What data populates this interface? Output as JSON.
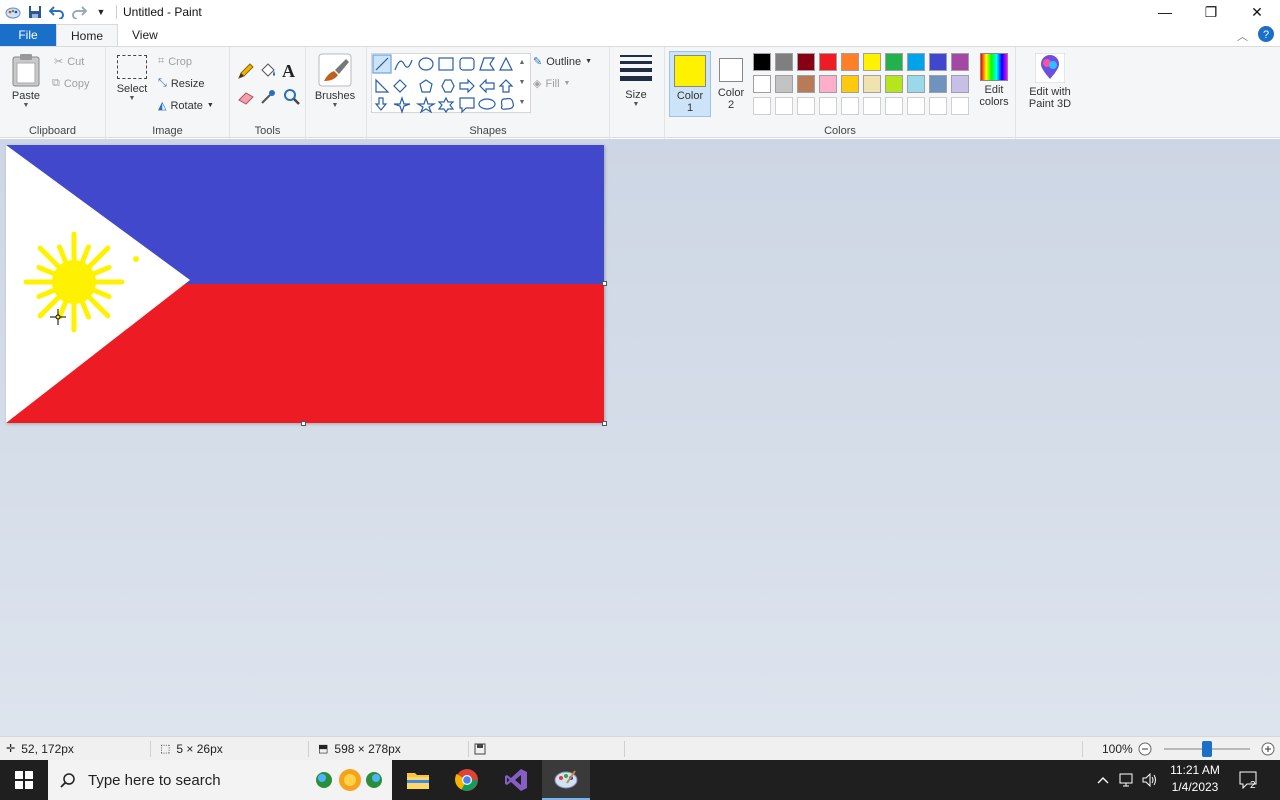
{
  "window": {
    "title": "Untitled - Paint",
    "controls": {
      "minimize": "—",
      "restore": "❐",
      "close": "✕"
    }
  },
  "tabs": {
    "file": "File",
    "home": "Home",
    "view": "View"
  },
  "ribbon": {
    "clipboard": {
      "label": "Clipboard",
      "paste": "Paste",
      "cut": "Cut",
      "copy": "Copy"
    },
    "image": {
      "label": "Image",
      "select": "Select",
      "crop": "Crop",
      "resize": "Resize",
      "rotate": "Rotate"
    },
    "tools": {
      "label": "Tools"
    },
    "brushes": {
      "label": "Brushes"
    },
    "shapes": {
      "label": "Shapes",
      "outline": "Outline",
      "fill": "Fill"
    },
    "size": {
      "label": "Size"
    },
    "colors": {
      "label": "Colors",
      "color1_line1": "Color",
      "color1_line2": "1",
      "color2_line1": "Color",
      "color2_line2": "2",
      "color1_value": "#fff200",
      "color2_value": "#ffffff",
      "edit_colors_line1": "Edit",
      "edit_colors_line2": "colors",
      "palette_row1": [
        "#000000",
        "#7f7f7f",
        "#880015",
        "#ed1c24",
        "#ff7f27",
        "#fff200",
        "#22b14c",
        "#00a2e8",
        "#3f48cc",
        "#a349a4"
      ],
      "palette_row2": [
        "#ffffff",
        "#c3c3c3",
        "#b97a57",
        "#ffaec9",
        "#ffc90e",
        "#efe4b0",
        "#b5e61d",
        "#99d9ea",
        "#7092be",
        "#c8bfe7"
      ]
    },
    "paint3d": {
      "line1": "Edit with",
      "line2": "Paint 3D"
    }
  },
  "canvas": {
    "flag_colors": {
      "blue": "#4148cc",
      "red": "#ed1c24",
      "white": "#ffffff",
      "sun": "#fff200"
    }
  },
  "status": {
    "cursor_pos": "52, 172px",
    "selection_size": "5 × 26px",
    "image_size": "598 × 278px",
    "zoom": "100%",
    "zoom_level": 0.5
  },
  "taskbar": {
    "search_placeholder": "Type here to search",
    "time": "11:21 AM",
    "date": "1/4/2023",
    "notification_count": "2"
  }
}
